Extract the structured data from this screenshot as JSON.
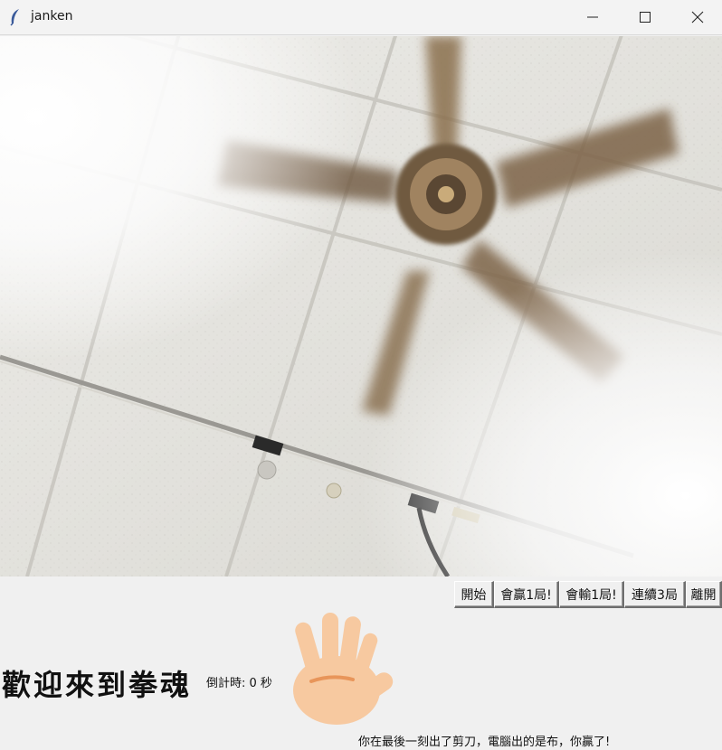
{
  "window": {
    "title": "janken",
    "icon": "feather-icon",
    "controls": [
      "minimize-icon",
      "maximize-icon",
      "close-icon"
    ]
  },
  "camera": {
    "scene": "ceiling-fan-camera-feed"
  },
  "buttons": {
    "start": "開始",
    "win_one": "會贏1局!",
    "lose_one": "會輸1局!",
    "streak_three": "連續3局",
    "leave": "離開"
  },
  "welcome_text": "歡迎來到拳魂",
  "countdown_text": "倒計時: 0 秒",
  "computer_hand": "paper-hand-icon",
  "result_text": "你在最後一刻出了剪刀，電腦出的是布，你贏了!"
}
